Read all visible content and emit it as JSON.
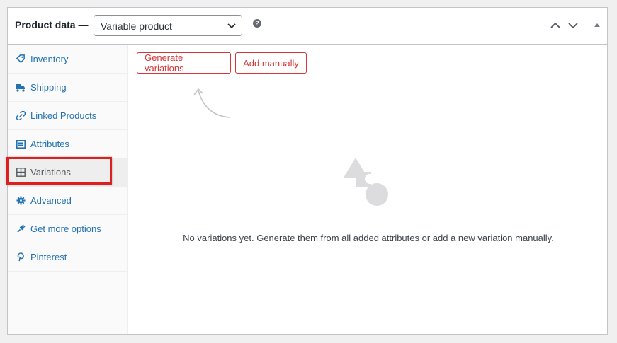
{
  "header": {
    "title": "Product data —",
    "product_type": "Variable product",
    "help_icon": "?",
    "icons": [
      "help-icon",
      "chevron-up-icon",
      "chevron-down-icon",
      "toggle-triangle-icon"
    ]
  },
  "sidebar": {
    "items": [
      {
        "label": "Inventory",
        "icon": "tag-icon"
      },
      {
        "label": "Shipping",
        "icon": "truck-icon"
      },
      {
        "label": "Linked Products",
        "icon": "link-icon"
      },
      {
        "label": "Attributes",
        "icon": "list-icon"
      },
      {
        "label": "Variations",
        "icon": "grid-icon",
        "active": true
      },
      {
        "label": "Advanced",
        "icon": "gear-icon"
      },
      {
        "label": "Get more options",
        "icon": "plugin-icon"
      },
      {
        "label": "Pinterest",
        "icon": "pinterest-icon"
      }
    ]
  },
  "content": {
    "generate_button": "Generate variations",
    "add_manually_button": "Add manually",
    "empty_message": "No variations yet. Generate them from all added attributes or add a new variation manually."
  },
  "colors": {
    "link": "#2271b1",
    "danger": "#d63638",
    "highlight": "#dd1f1f"
  }
}
